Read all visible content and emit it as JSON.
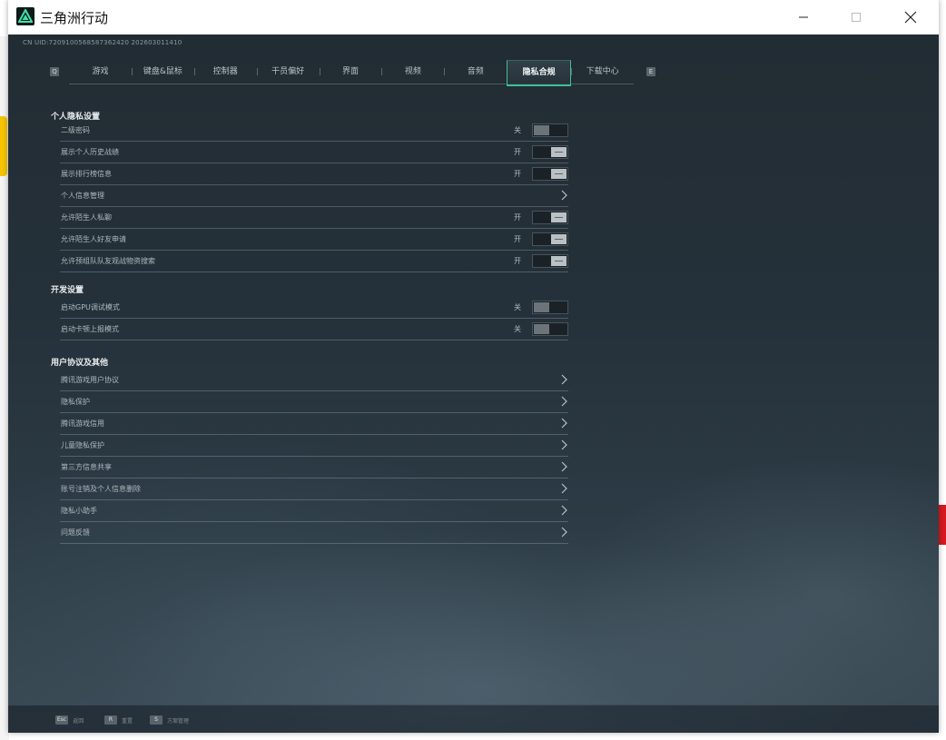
{
  "window": {
    "title": "三角洲行动",
    "uid": "CN UID:7209100568587362420 202603011410"
  },
  "tabs": {
    "left_key": "Q",
    "right_key": "E",
    "items": [
      {
        "label": "游戏",
        "active": false
      },
      {
        "label": "键盘&鼠标",
        "active": false
      },
      {
        "label": "控制器",
        "active": false
      },
      {
        "label": "干员偏好",
        "active": false
      },
      {
        "label": "界面",
        "active": false
      },
      {
        "label": "视频",
        "active": false
      },
      {
        "label": "音频",
        "active": false
      },
      {
        "label": "隐私合规",
        "active": true
      },
      {
        "label": "下载中心",
        "active": false
      }
    ]
  },
  "sections": [
    {
      "title": "个人隐私设置",
      "rows": [
        {
          "label": "二级密码",
          "type": "toggle",
          "state": "关",
          "on": false
        },
        {
          "label": "展示个人历史战绩",
          "type": "toggle",
          "state": "开",
          "on": true
        },
        {
          "label": "展示排行榜信息",
          "type": "toggle",
          "state": "开",
          "on": true
        },
        {
          "label": "个人信息管理",
          "type": "link"
        },
        {
          "label": "允许陌生人私聊",
          "type": "toggle",
          "state": "开",
          "on": true
        },
        {
          "label": "允许陌生人好友申请",
          "type": "toggle",
          "state": "开",
          "on": true
        },
        {
          "label": "允许预组队队友观战物资搜索",
          "type": "toggle",
          "state": "开",
          "on": true
        }
      ]
    },
    {
      "title": "开发设置",
      "rows": [
        {
          "label": "启动GPU调试模式",
          "type": "toggle",
          "state": "关",
          "on": false
        },
        {
          "label": "启动卡顿上报模式",
          "type": "toggle",
          "state": "关",
          "on": false
        }
      ]
    },
    {
      "title": "用户协议及其他",
      "rows": [
        {
          "label": "腾讯游戏用户协议",
          "type": "link"
        },
        {
          "label": "隐私保护",
          "type": "link"
        },
        {
          "label": "腾讯游戏信用",
          "type": "link"
        },
        {
          "label": "儿童隐私保护",
          "type": "link"
        },
        {
          "label": "第三方信息共享",
          "type": "link"
        },
        {
          "label": "账号注销及个人信息删除",
          "type": "link"
        },
        {
          "label": "隐私小助手",
          "type": "link"
        },
        {
          "label": "问题反馈",
          "type": "link"
        }
      ]
    }
  ],
  "footer": {
    "hints": [
      {
        "key": "Esc",
        "label": "返回"
      },
      {
        "key": "R",
        "label": "重置"
      },
      {
        "key": "S",
        "label": "方案管理"
      }
    ]
  },
  "colors": {
    "accent": "#3fbf9c",
    "panel_bg": "#222c33",
    "text": "#aeb8be"
  }
}
